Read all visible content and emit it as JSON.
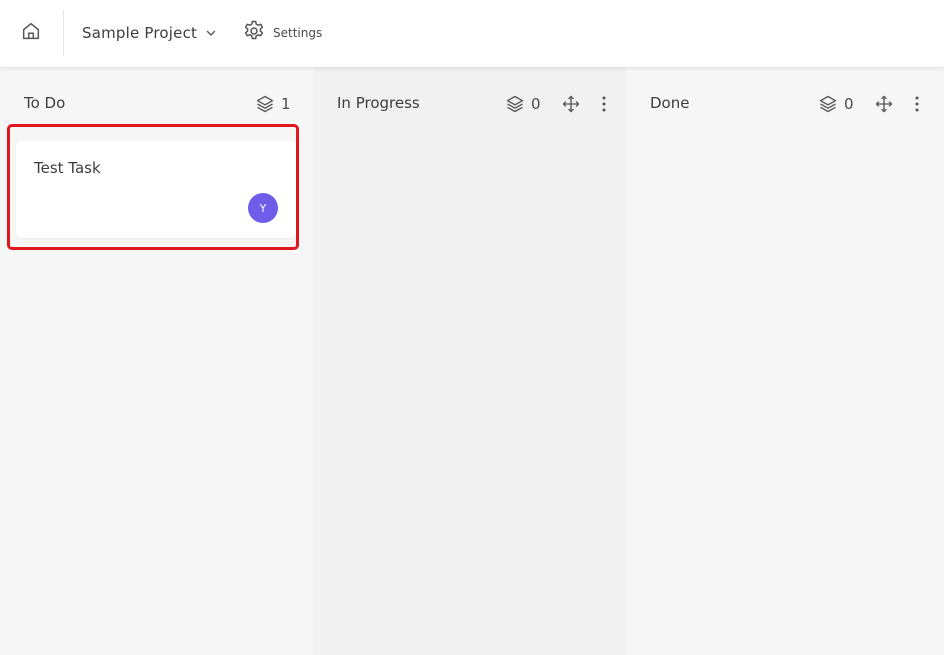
{
  "header": {
    "home_icon": "home-icon",
    "project_name": "Sample Project",
    "project_dropdown_icon": "chevron-down-icon",
    "settings_icon": "gear-icon",
    "settings_label": "Settings"
  },
  "columns": [
    {
      "title": "To Do",
      "count": "1",
      "icons": [
        "layers-icon"
      ]
    },
    {
      "title": "In Progress",
      "count": "0",
      "icons": [
        "layers-icon",
        "move-icon",
        "more-vertical-icon"
      ]
    },
    {
      "title": "Done",
      "count": "0",
      "icons": [
        "layers-icon",
        "move-icon",
        "more-vertical-icon"
      ]
    }
  ],
  "cards": [
    {
      "title": "Test Task",
      "assignee_initial": "Y",
      "avatar_color": "#6f5de9"
    }
  ],
  "colors": {
    "highlight": "#e0171e",
    "column_bg": "#f6f6f6",
    "column_bg_alt": "#f1f1f1"
  }
}
